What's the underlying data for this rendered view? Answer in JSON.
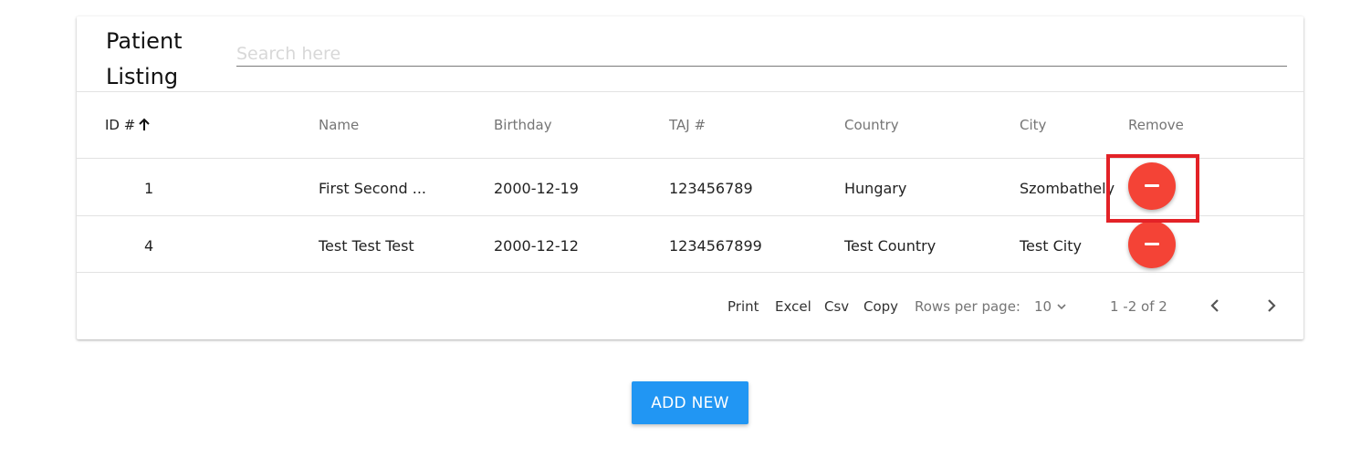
{
  "listing": {
    "title": "Patient Listing",
    "search_placeholder": "Search here"
  },
  "table": {
    "columns": [
      {
        "label": "ID #"
      },
      {
        "label": "Name"
      },
      {
        "label": "Birthday"
      },
      {
        "label": "TAJ #"
      },
      {
        "label": "Country"
      },
      {
        "label": "City"
      },
      {
        "label": "Remove"
      }
    ],
    "sort": {
      "column": "ID #",
      "direction": "ascending",
      "icon": "arrow-up-icon"
    },
    "rows": [
      {
        "id": "1",
        "name": "First Second ...",
        "birthday": "2000-12-19",
        "taj": "123456789",
        "country": "Hungary",
        "city": "Szombathely",
        "remove_icon": "minus-icon"
      },
      {
        "id": "4",
        "name": "Test Test Test",
        "birthday": "2000-12-12",
        "taj": "1234567899",
        "country": "Test Country",
        "city": "Test City",
        "remove_icon": "minus-icon"
      }
    ]
  },
  "footer": {
    "print": "Print",
    "excel": "Excel",
    "csv": "Csv",
    "copy": "Copy",
    "rows_per_page_label": "Rows per page:",
    "rows_per_page_value": "10",
    "range": "1 -2 of 2",
    "prev_icon": "chevron-left-icon",
    "next_icon": "chevron-right-icon"
  },
  "add_button": {
    "label": "ADD NEW"
  },
  "colors": {
    "remove": "#f44336",
    "primary": "#2196f3",
    "highlight": "#e32227",
    "muted_text": "#757575"
  }
}
